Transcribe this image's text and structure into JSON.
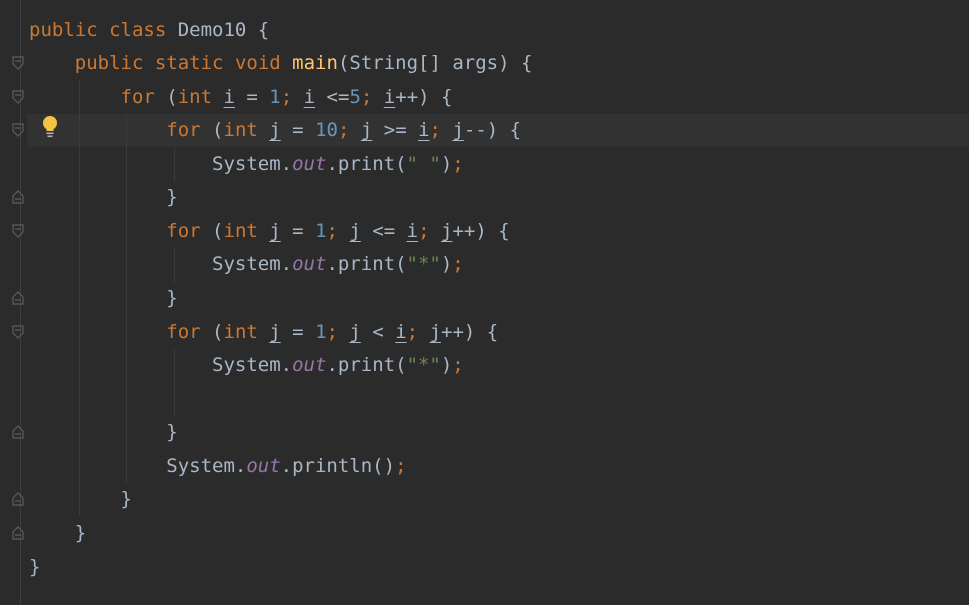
{
  "editor": {
    "lines": [
      [
        {
          "t": "public",
          "c": "kw"
        },
        {
          "t": " "
        },
        {
          "t": "class",
          "c": "kw"
        },
        {
          "t": " Demo10 {"
        }
      ],
      [
        {
          "t": "    "
        },
        {
          "t": "public",
          "c": "kw"
        },
        {
          "t": " "
        },
        {
          "t": "static",
          "c": "kw"
        },
        {
          "t": " "
        },
        {
          "t": "void",
          "c": "kw"
        },
        {
          "t": " "
        },
        {
          "t": "main",
          "c": "fn"
        },
        {
          "t": "(String[] args) {"
        }
      ],
      [
        {
          "t": "        "
        },
        {
          "t": "for",
          "c": "kw"
        },
        {
          "t": " ("
        },
        {
          "t": "int",
          "c": "kw"
        },
        {
          "t": " "
        },
        {
          "t": "i",
          "c": "ul"
        },
        {
          "t": " = "
        },
        {
          "t": "1",
          "c": "num"
        },
        {
          "t": ";",
          "c": "kw"
        },
        {
          "t": " "
        },
        {
          "t": "i",
          "c": "ul"
        },
        {
          "t": " <="
        },
        {
          "t": "5",
          "c": "num"
        },
        {
          "t": ";",
          "c": "kw"
        },
        {
          "t": " "
        },
        {
          "t": "i",
          "c": "ul"
        },
        {
          "t": "++) {"
        }
      ],
      [
        {
          "t": "            "
        },
        {
          "t": "for",
          "c": "kw"
        },
        {
          "t": " ("
        },
        {
          "t": "int",
          "c": "kw"
        },
        {
          "t": " "
        },
        {
          "t": "j",
          "c": "ul"
        },
        {
          "t": " = "
        },
        {
          "t": "10",
          "c": "num"
        },
        {
          "t": ";",
          "c": "kw"
        },
        {
          "t": " "
        },
        {
          "t": "j",
          "c": "ul"
        },
        {
          "t": " >= "
        },
        {
          "t": "i",
          "c": "ul"
        },
        {
          "t": ";",
          "c": "kw"
        },
        {
          "t": " "
        },
        {
          "t": "j",
          "c": "ul"
        },
        {
          "t": "--) {"
        }
      ],
      [
        {
          "t": "                System."
        },
        {
          "t": "out",
          "c": "fld"
        },
        {
          "t": ".print("
        },
        {
          "t": "\" \"",
          "c": "str"
        },
        {
          "t": ")"
        },
        {
          "t": ";",
          "c": "kw"
        }
      ],
      [
        {
          "t": "            }"
        }
      ],
      [
        {
          "t": "            "
        },
        {
          "t": "for",
          "c": "kw"
        },
        {
          "t": " ("
        },
        {
          "t": "int",
          "c": "kw"
        },
        {
          "t": " "
        },
        {
          "t": "j",
          "c": "ul"
        },
        {
          "t": " = "
        },
        {
          "t": "1",
          "c": "num"
        },
        {
          "t": ";",
          "c": "kw"
        },
        {
          "t": " "
        },
        {
          "t": "j",
          "c": "ul"
        },
        {
          "t": " <= "
        },
        {
          "t": "i",
          "c": "ul"
        },
        {
          "t": ";",
          "c": "kw"
        },
        {
          "t": " "
        },
        {
          "t": "j",
          "c": "ul"
        },
        {
          "t": "++) {"
        }
      ],
      [
        {
          "t": "                System."
        },
        {
          "t": "out",
          "c": "fld"
        },
        {
          "t": ".print("
        },
        {
          "t": "\"*\"",
          "c": "str"
        },
        {
          "t": ")"
        },
        {
          "t": ";",
          "c": "kw"
        }
      ],
      [
        {
          "t": "            }"
        }
      ],
      [
        {
          "t": "            "
        },
        {
          "t": "for",
          "c": "kw"
        },
        {
          "t": " ("
        },
        {
          "t": "int",
          "c": "kw"
        },
        {
          "t": " "
        },
        {
          "t": "j",
          "c": "ul"
        },
        {
          "t": " = "
        },
        {
          "t": "1",
          "c": "num"
        },
        {
          "t": ";",
          "c": "kw"
        },
        {
          "t": " "
        },
        {
          "t": "j",
          "c": "ul"
        },
        {
          "t": " < "
        },
        {
          "t": "i",
          "c": "ul"
        },
        {
          "t": ";",
          "c": "kw"
        },
        {
          "t": " "
        },
        {
          "t": "j",
          "c": "ul"
        },
        {
          "t": "++) {"
        }
      ],
      [
        {
          "t": "                System."
        },
        {
          "t": "out",
          "c": "fld"
        },
        {
          "t": ".print("
        },
        {
          "t": "\"*\"",
          "c": "str"
        },
        {
          "t": ")"
        },
        {
          "t": ";",
          "c": "kw"
        }
      ],
      [],
      [
        {
          "t": "            }"
        }
      ],
      [
        {
          "t": "            System."
        },
        {
          "t": "out",
          "c": "fld"
        },
        {
          "t": ".println()"
        },
        {
          "t": ";",
          "c": "kw"
        }
      ],
      [
        {
          "t": "        }"
        }
      ],
      [
        {
          "t": "    }"
        }
      ],
      [
        {
          "t": "}"
        }
      ]
    ],
    "gutter_icons": {
      "bulb": "lightbulb-icon",
      "fold_open": "fold-open-icon",
      "fold_close": "fold-close-icon"
    },
    "colors": {
      "background": "#2b2b2b",
      "keyword": "#cc7832",
      "function": "#ffc66d",
      "number": "#6897bb",
      "string": "#6a8759",
      "field": "#9876aa",
      "text": "#a9b7c6"
    }
  }
}
